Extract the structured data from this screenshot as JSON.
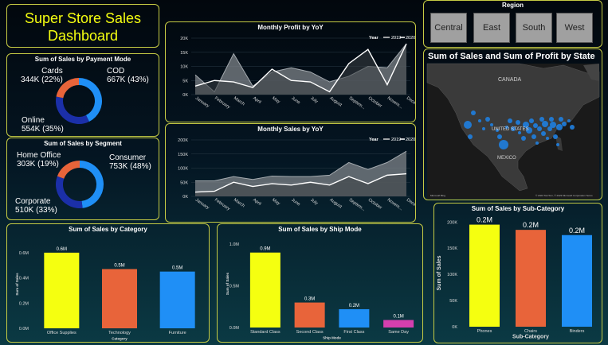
{
  "header": {
    "title_line1": "Super Store Sales",
    "title_line2": "Dashboard"
  },
  "region": {
    "title": "Region",
    "buttons": [
      "Central",
      "East",
      "South",
      "West"
    ]
  },
  "payment": {
    "title": "Sum of Sales by Payment Mode",
    "slices": [
      {
        "label": "COD",
        "value_text": "667K (43%)",
        "value": 667,
        "color": "#1f8ff6"
      },
      {
        "label": "Online",
        "value_text": "554K (35%)",
        "value": 554,
        "color": "#1b2fa8"
      },
      {
        "label": "Cards",
        "value_text": "344K (22%)",
        "value": 344,
        "color": "#e8643a"
      }
    ]
  },
  "segment": {
    "title": "Sum of Sales by Segment",
    "slices": [
      {
        "label": "Consumer",
        "value_text": "753K (48%)",
        "value": 753,
        "color": "#1f8ff6"
      },
      {
        "label": "Corporate",
        "value_text": "510K (33%)",
        "value": 510,
        "color": "#1b2fa8"
      },
      {
        "label": "Home Office",
        "value_text": "303K (19%)",
        "value": 303,
        "color": "#e8643a"
      }
    ]
  },
  "profit_chart": {
    "title": "Monthly Profit by YoY",
    "legend_title": "Year",
    "legend": [
      "2019",
      "2020"
    ],
    "yticks": [
      "0K",
      "5K",
      "10K",
      "15K",
      "20K"
    ],
    "ymax": 20,
    "months": [
      "January",
      "February",
      "March",
      "April",
      "May",
      "June",
      "July",
      "August",
      "Septem...",
      "October",
      "Novem...",
      "Decemb..."
    ],
    "series2019": [
      7,
      1,
      14.5,
      3,
      8,
      9.5,
      8,
      4.5,
      6.5,
      10,
      9.5,
      18
    ],
    "series2020": [
      3,
      5,
      4.5,
      2.5,
      9,
      5,
      4.5,
      1,
      11,
      16,
      3.5,
      18
    ]
  },
  "sales_chart": {
    "title": "Monthly Sales by YoY",
    "legend_title": "Year",
    "legend": [
      "2019",
      "2020"
    ],
    "yticks": [
      "0K",
      "50K",
      "100K",
      "150K",
      "200K"
    ],
    "ymax": 200,
    "months": [
      "January",
      "February",
      "March",
      "April",
      "May",
      "June",
      "July",
      "August",
      "Septem...",
      "October",
      "Novem...",
      "Decemb..."
    ],
    "series2019": [
      55,
      55,
      70,
      60,
      72,
      70,
      70,
      75,
      120,
      95,
      120,
      160
    ],
    "series2020": [
      15,
      18,
      50,
      35,
      45,
      40,
      50,
      40,
      70,
      45,
      75,
      80
    ]
  },
  "map": {
    "title": "Sum of Sales and Sum of Profit by State",
    "labels": [
      "CANADA",
      "UNITED STATES",
      "MEXICO"
    ],
    "footer_left": "Microsoft Bing",
    "footer_right": "© 2023 TomTom, © 2023 Microsoft Corporation  Terms"
  },
  "chart_data": [
    {
      "type": "bar",
      "title": "Sum of Sales by Category",
      "categories": [
        "Office Supplies",
        "Technology",
        "Furniture"
      ],
      "values": [
        0.6,
        0.47,
        0.45
      ],
      "data_labels": [
        "0.6M",
        "0.5M",
        "0.5M"
      ],
      "xlabel": "Category",
      "ylabel": "Sum of Sales",
      "yticks": [
        "0.0M",
        "0.2M",
        "0.4M",
        "0.6M"
      ],
      "ylim": [
        0,
        0.7
      ],
      "colors": [
        "#f5ff10",
        "#e8643a",
        "#1f8ff6"
      ]
    },
    {
      "type": "bar",
      "title": "Sum of Sales by Ship Mode",
      "categories": [
        "Standard Class",
        "Second Class",
        "First Class",
        "Same Day"
      ],
      "values": [
        0.9,
        0.3,
        0.22,
        0.09
      ],
      "data_labels": [
        "0.9M",
        "0.3M",
        "0.2M",
        "0.1M"
      ],
      "xlabel": "Ship Mode",
      "ylabel": "Sum of Sales",
      "yticks": [
        "0.0M",
        "0.5M",
        "1.0M"
      ],
      "ylim": [
        0,
        1.05
      ],
      "colors": [
        "#f5ff10",
        "#e8643a",
        "#1f8ff6",
        "#d43fae"
      ]
    },
    {
      "type": "bar",
      "title": "Sum of Sales by Sub-Category",
      "categories": [
        "Phones",
        "Chairs",
        "Binders"
      ],
      "values": [
        195000,
        185000,
        175000
      ],
      "data_labels": [
        "0.2M",
        "0.2M",
        "0.2M"
      ],
      "xlabel": "Sub-Category",
      "ylabel": "Sum of Sales",
      "yticks": [
        "0K",
        "50K",
        "100K",
        "150K",
        "200K"
      ],
      "ylim": [
        0,
        205000
      ],
      "colors": [
        "#f5ff10",
        "#e8643a",
        "#1f8ff6"
      ]
    }
  ]
}
